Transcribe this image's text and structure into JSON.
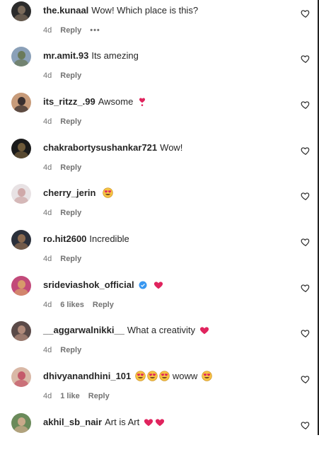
{
  "comments": [
    {
      "username": "the.kunaal",
      "text": "Wow! Which place is this?",
      "time": "4d",
      "likes": "",
      "reply": "Reply",
      "more": "•••",
      "avatar_colors": [
        "#2b2b2b",
        "#7a6a5a"
      ]
    },
    {
      "username": "mr.amit.93",
      "text": "Its amezing",
      "time": "4d",
      "likes": "",
      "reply": "Reply",
      "avatar_colors": [
        "#8aa0b8",
        "#6a7a5a"
      ]
    },
    {
      "username": "its_ritzz_.99",
      "text": "Awsome",
      "emoji_after": "heart-exclamation-emoji",
      "time": "4d",
      "likes": "",
      "reply": "Reply",
      "avatar_colors": [
        "#c79b7a",
        "#3a3030"
      ]
    },
    {
      "username": "chakrabortysushankar721",
      "text": "Wow!",
      "time": "4d",
      "likes": "",
      "reply": "Reply",
      "avatar_colors": [
        "#1a1a1a",
        "#6e5a3a"
      ]
    },
    {
      "username": "cherry_jerin",
      "text": "",
      "emoji_after": "heart-eyes-emoji",
      "time": "4d",
      "likes": "",
      "reply": "Reply",
      "avatar_colors": [
        "#e8e2e4",
        "#cfa9a9"
      ]
    },
    {
      "username": "ro.hit2600",
      "text": "Incredible",
      "time": "4d",
      "likes": "",
      "reply": "Reply",
      "avatar_colors": [
        "#2a2f3a",
        "#8a6a50"
      ]
    },
    {
      "username": "srideviashok_official",
      "text": "",
      "verified": true,
      "emoji_after": "red-heart-emoji",
      "time": "4d",
      "likes": "6 likes",
      "reply": "Reply",
      "avatar_colors": [
        "#c24a7a",
        "#d79a6a"
      ]
    },
    {
      "username": "__aggarwalnikki__",
      "text": "What a creativity",
      "emoji_after": "red-heart-emoji",
      "time": "4d",
      "likes": "",
      "reply": "Reply",
      "avatar_colors": [
        "#5a4a48",
        "#b08a7a"
      ]
    },
    {
      "username": "dhivyanandhini_101",
      "text": "woww",
      "emoji_before": "heart-eyes-emoji-x3",
      "emoji_after": "heart-eyes-emoji",
      "time": "4d",
      "likes": "1 like",
      "reply": "Reply",
      "avatar_colors": [
        "#d9b8a6",
        "#c45a6a"
      ]
    },
    {
      "username": "akhil_sb_nair",
      "text": "Art is Art",
      "emoji_after": "red-heart-emoji-x2",
      "time": "",
      "likes": "",
      "reply": "",
      "avatar_colors": [
        "#6a8a5a",
        "#c9a98a"
      ]
    }
  ],
  "colors": {
    "text": "#262626",
    "meta": "#737373",
    "heart_red": "#e0245e",
    "emoji_yellow": "#f6c343",
    "verified_blue": "#3897f0"
  },
  "icons": {
    "like": "heart-outline-icon",
    "verified": "verified-badge-icon"
  }
}
